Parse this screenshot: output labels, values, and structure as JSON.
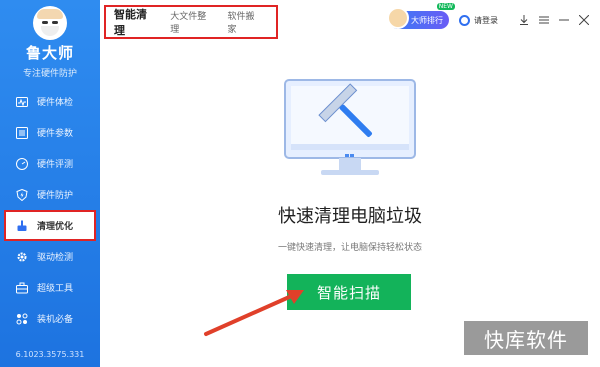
{
  "sidebar": {
    "logo_name": "鲁大师",
    "logo_sub": "专注硬件防护",
    "items": [
      {
        "label": "硬件体检",
        "icon": "pulse-icon"
      },
      {
        "label": "硬件参数",
        "icon": "list-icon"
      },
      {
        "label": "硬件评测",
        "icon": "speedometer-icon"
      },
      {
        "label": "硬件防护",
        "icon": "shield-icon"
      },
      {
        "label": "清理优化",
        "icon": "broom-icon"
      },
      {
        "label": "驱动检测",
        "icon": "gear-icon"
      },
      {
        "label": "超级工具",
        "icon": "toolbox-icon"
      },
      {
        "label": "装机必备",
        "icon": "apps-icon"
      }
    ],
    "active_index": 4,
    "version": "6.1023.3575.331"
  },
  "tabs": [
    "智能清理",
    "大文件整理",
    "软件搬家"
  ],
  "header": {
    "rank_label": "大师排行",
    "rank_badge": "NEW",
    "login_label": "请登录"
  },
  "main": {
    "title": "快速清理电脑垃圾",
    "subtitle": "一键快速清理，让电脑保持轻松状态",
    "scan_button": "智能扫描"
  },
  "watermark": "快库软件",
  "colors": {
    "sidebar": "#1d73e0",
    "accent_green": "#13b35a",
    "highlight_red": "#e02424"
  }
}
